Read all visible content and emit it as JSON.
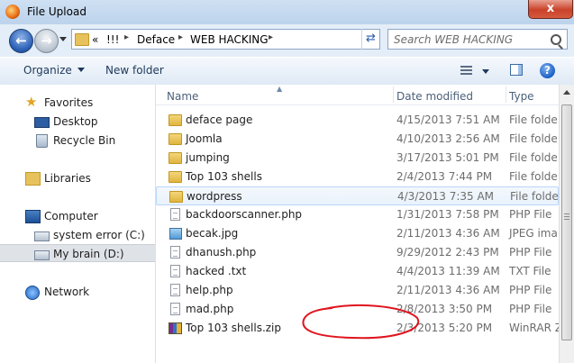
{
  "window": {
    "title": "File Upload",
    "close_label": "x"
  },
  "address_bar": {
    "overflow": "«",
    "crumbs": [
      "!!!",
      "Deface",
      "WEB HACKING"
    ]
  },
  "search": {
    "placeholder": "Search WEB HACKING"
  },
  "toolbar": {
    "organize": "Organize",
    "new_folder": "New folder"
  },
  "nav_pane": {
    "favorites": {
      "label": "Favorites",
      "items": [
        "Desktop",
        "Recycle Bin"
      ]
    },
    "libraries": {
      "label": "Libraries"
    },
    "computer": {
      "label": "Computer",
      "items": [
        "system error (C:)",
        "My brain (D:)"
      ]
    },
    "network": {
      "label": "Network"
    }
  },
  "columns": {
    "name": "Name",
    "date": "Date modified",
    "type": "Type"
  },
  "files": [
    {
      "name": "deface page",
      "date": "4/15/2013 7:51 AM",
      "type": "File folde",
      "icon": "folder-icon"
    },
    {
      "name": "Joomla",
      "date": "4/10/2013 2:56 AM",
      "type": "File folde",
      "icon": "folder-icon"
    },
    {
      "name": "jumping",
      "date": "3/17/2013 5:01 PM",
      "type": "File folde",
      "icon": "folder-icon"
    },
    {
      "name": "Top 103 shells",
      "date": "2/4/2013 7:44 PM",
      "type": "File folde",
      "icon": "folder-icon"
    },
    {
      "name": "wordpress",
      "date": "4/3/2013 7:35 AM",
      "type": "File folde",
      "icon": "folder-icon"
    },
    {
      "name": "backdoorscanner.php",
      "date": "1/31/2013 7:58 PM",
      "type": "PHP File",
      "icon": "php-file-icon"
    },
    {
      "name": "becak.jpg",
      "date": "2/11/2013 4:36 AM",
      "type": "JPEG ima",
      "icon": "image-file-icon"
    },
    {
      "name": "dhanush.php",
      "date": "9/29/2012 2:43 PM",
      "type": "PHP File",
      "icon": "php-file-icon"
    },
    {
      "name": "hacked .txt",
      "date": "4/4/2013 11:39 AM",
      "type": "TXT File",
      "icon": "text-file-icon"
    },
    {
      "name": "help.php",
      "date": "2/11/2013 4:36 AM",
      "type": "PHP File",
      "icon": "php-file-icon"
    },
    {
      "name": "mad.php",
      "date": "2/8/2013 3:50 PM",
      "type": "PHP File",
      "icon": "php-file-icon"
    },
    {
      "name": "Top 103 shells.zip",
      "date": "2/3/2013 5:20 PM",
      "type": "WinRAR Z",
      "icon": "zip-archive-icon"
    }
  ],
  "annotation_color": "#e0141e"
}
